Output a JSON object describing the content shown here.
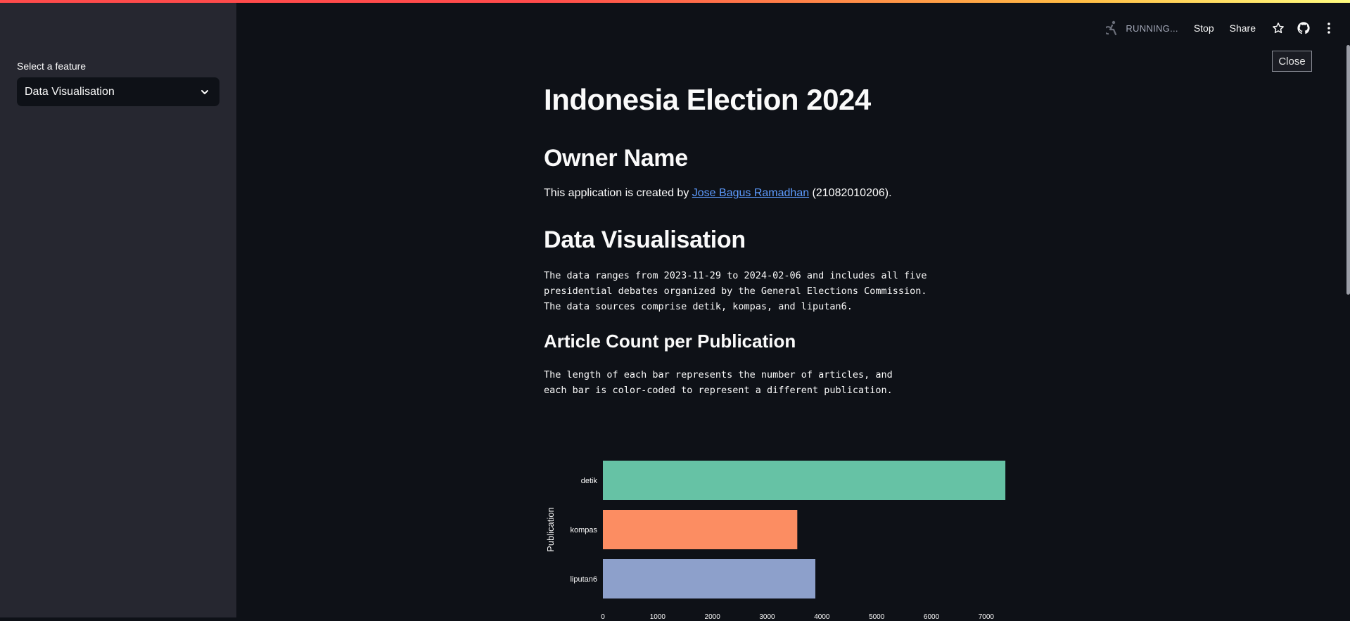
{
  "sidebar": {
    "select_label": "Select a feature",
    "select_value": "Data Visualisation"
  },
  "toolbar": {
    "status": "RUNNING...",
    "stop_label": "Stop",
    "share_label": "Share",
    "icons": [
      "running-man-icon",
      "star-icon",
      "github-icon",
      "kebab-menu-icon"
    ]
  },
  "tooltip": {
    "close_label": "Close"
  },
  "main": {
    "title": "Indonesia Election 2024",
    "owner_heading": "Owner Name",
    "creator_prefix": "This application is created by ",
    "creator_name": "Jose Bagus Ramadhan",
    "creator_suffix": " (21082010206).",
    "viz_heading": "Data Visualisation",
    "viz_description": [
      "The data ranges from 2023-11-29 to 2024-02-06 and includes all five",
      "presidential debates organized by the General Elections Commission.",
      "The data sources comprise detik, kompas, and liputan6."
    ],
    "article_heading": "Article Count per Publication",
    "article_description": [
      "The length of each bar represents the number of articles, and",
      "each bar is color-coded to represent a different publication."
    ]
  },
  "chart_data": {
    "type": "bar",
    "orientation": "horizontal",
    "categories": [
      "detik",
      "kompas",
      "liputan6"
    ],
    "values": [
      7350,
      3550,
      3880
    ],
    "colors": [
      "#66c2a5",
      "#fc8d62",
      "#8da0cb"
    ],
    "ylabel": "Publication",
    "xlabel": "",
    "xlim": [
      0,
      7400
    ],
    "xticks": [
      0,
      1000,
      2000,
      3000,
      4000,
      5000,
      6000,
      7000
    ],
    "grid": false
  },
  "colors": {
    "background": "#0e1117",
    "sidebar": "#262730",
    "link": "#5e9cff"
  }
}
